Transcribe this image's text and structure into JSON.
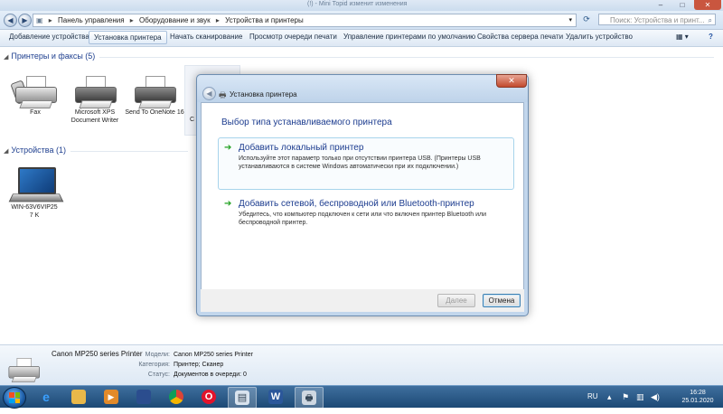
{
  "explorer": {
    "title_text": "(!) - Mini Тоpid изменит изменения",
    "breadcrumb": [
      "Панель управления",
      "Оборудование и звук",
      "Устройства и принтеры"
    ],
    "search_placeholder": "Поиск: Устройства и принт...",
    "toolbar": [
      "Добавление устройства",
      "Установка принтера",
      "Начать сканирование",
      "Просмотр очереди печати",
      "Управление принтерами по умолчанию",
      "Свойства сервера печати",
      "Удалить устройство"
    ],
    "groups": {
      "printers": {
        "header": "Принтеры и факсы (5)",
        "items": [
          "Fax",
          "Microsoft XPS Document Writer",
          "Send To OneNote 16",
          "C"
        ]
      },
      "devices": {
        "header": "Устройства (1)",
        "items": [
          "WIN-63V6VIP257 K"
        ]
      }
    }
  },
  "dialog": {
    "caption": "Установка принтера",
    "heading": "Выбор типа устанавливаемого принтера",
    "options": [
      {
        "title": "Добавить локальный принтер",
        "desc": "Используйте этот параметр только при отсутствии принтера USB. (Принтеры USB устанавливаются в системе Windows автоматически при их подключении.)"
      },
      {
        "title": "Добавить сетевой, беспроводной или Bluetooth-принтер",
        "desc": "Убедитесь, что компьютер подключен к сети или что включен принтер Bluetooth или беспроводной принтер."
      }
    ],
    "next_label": "Далее",
    "cancel_label": "Отмена"
  },
  "details": {
    "name": "Canon MP250 series Printer",
    "model_label": "Модели:",
    "model_value": "Canon MP250 series Printer",
    "category_label": "Категория:",
    "category_value": "Принтер; Сканер",
    "status_label": "Статус:",
    "status_value": "Документов в очереди: 0"
  },
  "taskbar": {
    "lang": "RU",
    "time": "16:28",
    "date": "25.01.2020",
    "app_icons": [
      "start-icon",
      "ie-icon",
      "explorer-icon",
      "media-player-icon",
      "floppy-icon",
      "chrome-icon",
      "opera-icon",
      "control-panel-icon",
      "word-icon",
      "printer-wizard-icon"
    ]
  },
  "colors": {
    "link_blue": "#1c3c8f",
    "green_arrow": "#21a121",
    "taskbar": "#1c4975"
  }
}
